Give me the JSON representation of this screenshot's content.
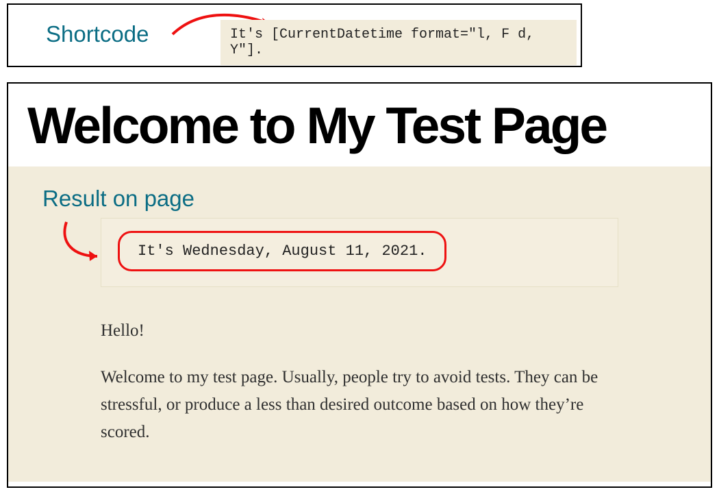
{
  "annotations": {
    "shortcode_label": "Shortcode",
    "result_label": "Result on page"
  },
  "shortcode_example": "It's [CurrentDatetime format=\"l, F d, Y\"].",
  "page": {
    "title": "Welcome to My Test Page",
    "result_text": "It's Wednesday, August 11, 2021.",
    "greeting": "Hello!",
    "paragraph": "Welcome to my test page. Usually, people try to avoid tests. They can be stressful, or produce a less than desired outcome based on how they’re scored."
  },
  "colors": {
    "annotation_text": "#0b6d84",
    "annotation_arrow": "#e11",
    "body_bg": "#f2ecdb"
  }
}
